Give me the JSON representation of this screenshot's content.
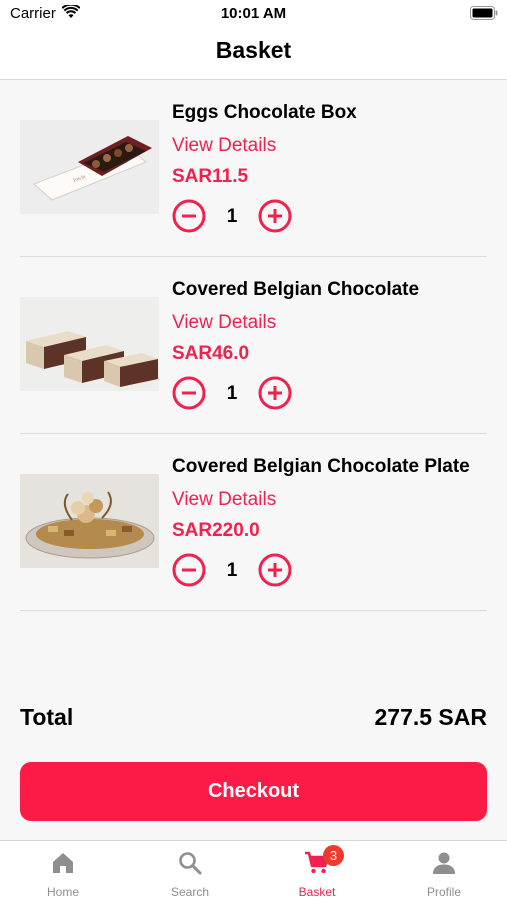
{
  "status_bar": {
    "carrier": "Carrier",
    "time": "10:01 AM"
  },
  "header": {
    "title": "Basket"
  },
  "items": [
    {
      "name": "Eggs Chocolate Box",
      "details_link": "View Details",
      "price": "SAR11.5",
      "quantity": "1"
    },
    {
      "name": "Covered Belgian Chocolate",
      "details_link": "View Details",
      "price": "SAR46.0",
      "quantity": "1"
    },
    {
      "name": "Covered Belgian Chocolate Plate",
      "details_link": "View Details",
      "price": "SAR220.0",
      "quantity": "1"
    }
  ],
  "summary": {
    "total_label": "Total",
    "total_value": "277.5 SAR"
  },
  "checkout": {
    "label": "Checkout"
  },
  "tabs": [
    {
      "label": "Home",
      "icon": "home-icon"
    },
    {
      "label": "Search",
      "icon": "search-icon"
    },
    {
      "label": "Basket",
      "icon": "cart-icon",
      "badge": "3",
      "active": true
    },
    {
      "label": "Profile",
      "icon": "person-icon"
    }
  ],
  "colors": {
    "accent": "#f0214f",
    "checkout_button": "#fc1a46",
    "badge": "#ef3a2c",
    "inactive_tab": "#8e8e8e"
  }
}
